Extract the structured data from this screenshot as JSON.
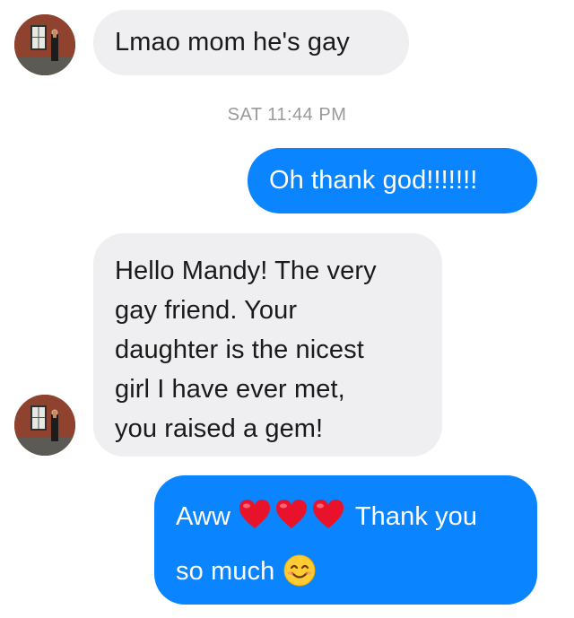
{
  "conversation": {
    "messages": [
      {
        "direction": "incoming",
        "text": "Lmao mom he's gay"
      },
      {
        "direction": "outgoing",
        "text": "Oh thank god!!!!!!!"
      },
      {
        "direction": "incoming",
        "lines": [
          "Hello Mandy! The very",
          "gay friend. Your",
          "daughter is the nicest",
          "girl I have ever met,",
          "you raised a gem!"
        ]
      },
      {
        "direction": "outgoing",
        "line1_prefix": "Aww",
        "line1_suffix": "Thank you",
        "line2": "so much",
        "emojis": [
          "red-heart",
          "red-heart",
          "red-heart",
          "smiling-face"
        ]
      }
    ],
    "timestamp": "SAT 11:44 PM"
  },
  "colors": {
    "incoming_bubble": "#efeff1",
    "outgoing_bubble": "#0a84ff",
    "timestamp_text": "#9a9a9e"
  }
}
